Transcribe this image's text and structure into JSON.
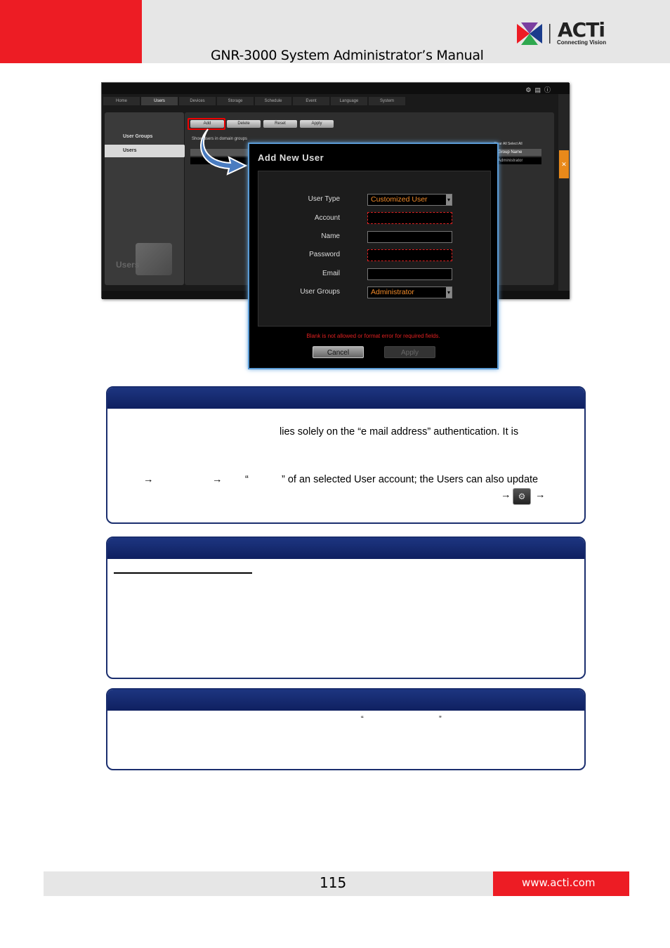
{
  "header": {
    "title": "GNR-3000 System Administrator’s Manual",
    "logo_text": "ACTi",
    "logo_tagline": "Connecting Vision"
  },
  "app": {
    "tabs": [
      "Home",
      "Users",
      "Devices",
      "Storage",
      "Schedule",
      "Event",
      "Language",
      "System"
    ],
    "active_tab": "Users",
    "sidebar": {
      "user_groups": "User Groups",
      "users": "Users",
      "watermark": "Users"
    },
    "toolbar": {
      "add": "Add",
      "delete": "Delete",
      "reset": "Reset",
      "apply": "Apply"
    },
    "domain_checkbox": "Show users in domain groups",
    "grid_header_col": "Group Name",
    "grid_row_col": "Administrator",
    "grid_select_controls": "Clear All  Select All"
  },
  "dialog": {
    "title": "Add New User",
    "fields": {
      "user_type_label": "User Type",
      "user_type_value": "Customized User",
      "account_label": "Account",
      "name_label": "Name",
      "password_label": "Password",
      "email_label": "Email",
      "user_groups_label": "User Groups",
      "user_groups_value": "Administrator"
    },
    "error": "Blank is not allowed or format error for required fields.",
    "cancel": "Cancel",
    "apply": "Apply"
  },
  "notes": {
    "box1_line1": "lies solely on the “e mail address” authentication. It is",
    "box1_quote": "“",
    "box1_line2": "” of an selected User account; the Users can also update",
    "box3_q1": "“",
    "box3_q2": "”"
  },
  "footer": {
    "page": "115",
    "url": "www.acti.com"
  },
  "colors": {
    "brand_red": "#ed1c24",
    "box_navy": "#1a2e6e",
    "highlight_orange": "#f08a2a"
  }
}
